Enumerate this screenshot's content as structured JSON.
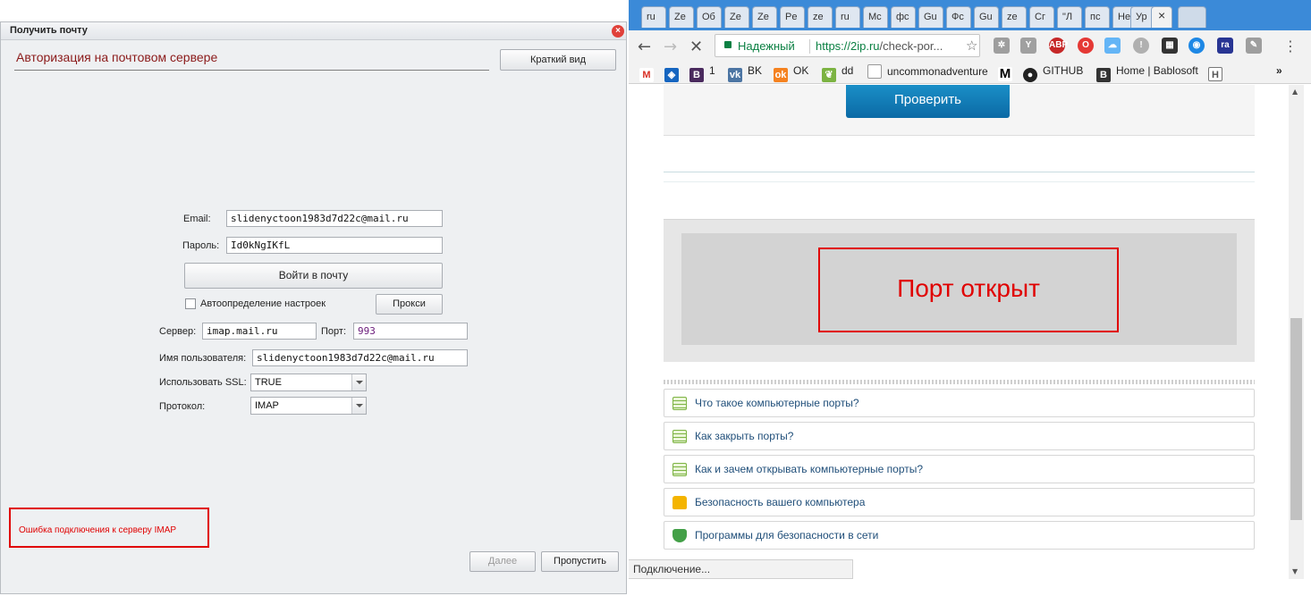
{
  "dialog": {
    "title": "Получить почту",
    "close": "×",
    "heading": "Авторизация на почтовом сервере",
    "brief_view_button": "Краткий вид",
    "email_label": "Email:",
    "email_value": "slidenyctoon1983d7d22c@mail.ru",
    "password_label": "Пароль:",
    "password_value": "Id0kNgIKfL",
    "login_button": "Войти в почту",
    "autodetect_label": "Автоопределение настроек",
    "autodetect_checked": false,
    "proxy_button": "Прокси",
    "server_label": "Сервер:",
    "server_value": "imap.mail.ru",
    "port_label": "Порт:",
    "port_value": "993",
    "username_label": "Имя пользователя:",
    "username_value": "slidenyctoon1983d7d22c@mail.ru",
    "ssl_label": "Использовать SSL:",
    "ssl_value": "TRUE",
    "protocol_label": "Протокол:",
    "protocol_value": "IMAP",
    "error_text": "Ошибка подключения к серверу IMAP",
    "next_button": "Далее",
    "skip_button": "Пропустить"
  },
  "browser": {
    "tabs": [
      "ru",
      "Ze",
      "Об",
      "Ze",
      "Ze",
      "Pe",
      "ze",
      "ru",
      "Mc",
      "фс",
      "Gu",
      "Фс",
      "Gu",
      "ze",
      "Сг",
      "\"Л",
      "пс",
      "Не",
      "Ур"
    ],
    "active_tab_close": "×",
    "secure_label": "Надежный",
    "url_host": "https://2ip.ru",
    "url_rest": "/check-por...",
    "bookmarks": [
      {
        "icon": "gmail-icon",
        "label": ""
      },
      {
        "icon": "blue-icon",
        "label": ""
      },
      {
        "icon": "b-icon",
        "label": "1"
      },
      {
        "icon": "vk-icon",
        "label": "BK"
      },
      {
        "icon": "ok-icon",
        "label": "OK"
      },
      {
        "icon": "leaf-icon",
        "label": "dd"
      },
      {
        "icon": "page-icon",
        "label": "uncommonadventure"
      },
      {
        "icon": "m-icon",
        "label": ""
      },
      {
        "icon": "github-icon",
        "label": "GITHUB"
      },
      {
        "icon": "bablosoft-icon",
        "label": "Home | Bablosoft"
      },
      {
        "icon": "h-icon",
        "label": ""
      }
    ],
    "bookmarks_more": "»",
    "check_button": "Проверить",
    "result_text": "Порт открыт",
    "links": [
      {
        "icon": "document-icon",
        "label": "Что такое компьютерные порты?"
      },
      {
        "icon": "document-icon",
        "label": "Как закрыть порты?"
      },
      {
        "icon": "document-icon",
        "label": "Как и зачем открывать компьютерные порты?"
      },
      {
        "icon": "lock-icon",
        "label": "Безопасность вашего компьютера"
      },
      {
        "icon": "shield-icon",
        "label": "Программы для безопасности в сети"
      }
    ],
    "status_text": "Подключение...",
    "colors": {
      "accent": "#3b8ad8",
      "error": "#e00000",
      "check_button": "#1a8fc7"
    }
  }
}
